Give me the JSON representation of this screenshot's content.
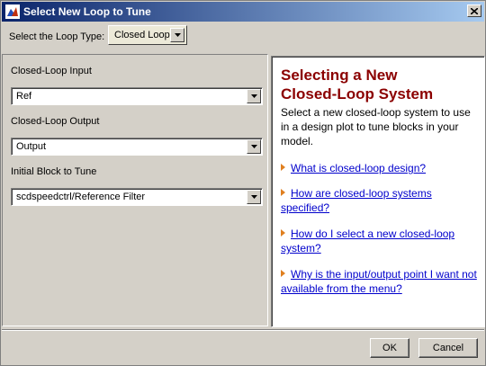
{
  "window": {
    "title": "Select New Loop to Tune"
  },
  "loop_type": {
    "label": "Select the Loop Type:",
    "value": "Closed Loop"
  },
  "fields": [
    {
      "label": "Closed-Loop Input",
      "value": "Ref"
    },
    {
      "label": "Closed-Loop Output",
      "value": "Output"
    },
    {
      "label": "Initial Block to Tune",
      "value": "scdspeedctrl/Reference Filter"
    }
  ],
  "help": {
    "title_line1": "Selecting a New",
    "title_line2": "Closed-Loop System",
    "body": "Select a new closed-loop system to use in a design plot to tune blocks in your model.",
    "links": [
      "What is closed-loop design?",
      "How are closed-loop systems specified?",
      "How do I select a new closed-loop system?",
      "Why is the input/output point I want not available from the menu?"
    ]
  },
  "buttons": {
    "ok": "OK",
    "cancel": "Cancel"
  },
  "colors": {
    "help_title": "#8b0000",
    "link": "#0000cc",
    "bullet": "#e08020",
    "titlebar_start": "#0a246a"
  }
}
